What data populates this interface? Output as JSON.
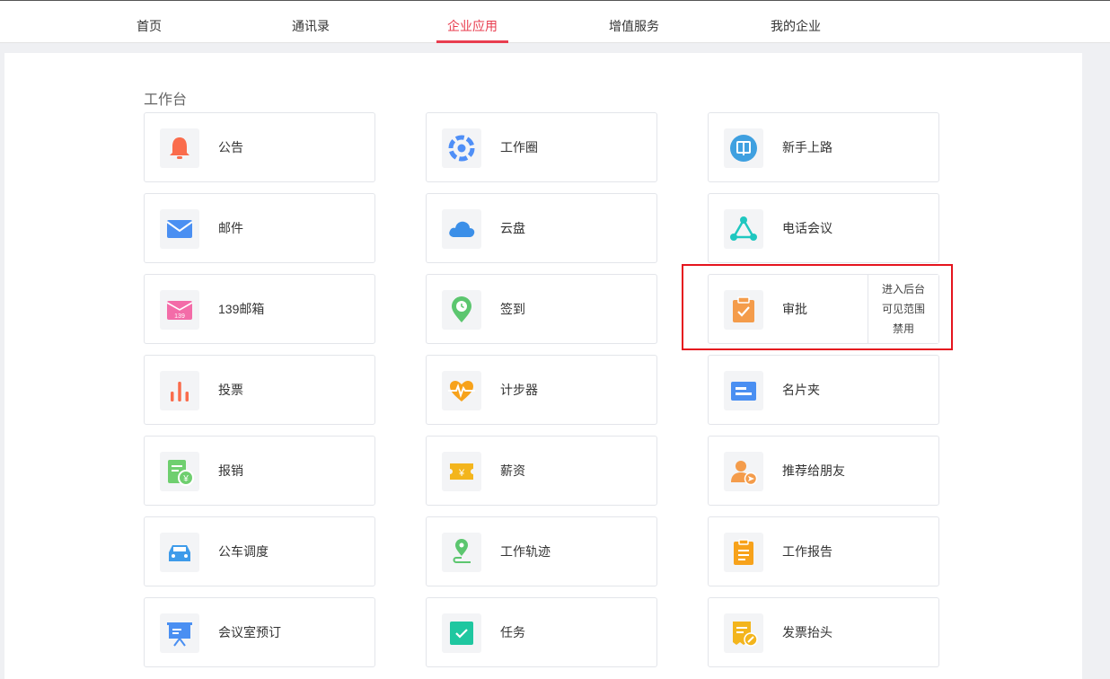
{
  "nav": {
    "items": [
      {
        "label": "首页"
      },
      {
        "label": "通讯录"
      },
      {
        "label": "企业应用"
      },
      {
        "label": "增值服务"
      },
      {
        "label": "我的企业"
      }
    ],
    "active_index": 2,
    "active_color": "#e83d4f"
  },
  "section": {
    "title": "工作台"
  },
  "apps": [
    {
      "label": "公告",
      "icon": "bell-icon",
      "color": "#fa6c4c"
    },
    {
      "label": "工作圈",
      "icon": "work-circle-icon",
      "color": "#4f8ff7"
    },
    {
      "label": "新手上路",
      "icon": "beginner-guide-icon",
      "color": "#3fa0e0"
    },
    {
      "label": "邮件",
      "icon": "mail-icon",
      "color": "#4a8ff2"
    },
    {
      "label": "云盘",
      "icon": "cloud-icon",
      "color": "#3b8fe8"
    },
    {
      "label": "电话会议",
      "icon": "phone-conference-icon",
      "color": "#1fc7c0"
    },
    {
      "label": "139邮箱",
      "icon": "mailbox-139-icon",
      "color": "#f36ca8",
      "badge": "139"
    },
    {
      "label": "签到",
      "icon": "check-in-location-icon",
      "color": "#5cc66f"
    },
    {
      "label": "审批",
      "icon": "approval-clipboard-icon",
      "color": "#f49c4b"
    },
    {
      "label": "投票",
      "icon": "vote-bar-chart-icon",
      "color": "#fa6c4c"
    },
    {
      "label": "计步器",
      "icon": "pedometer-heartbeat-icon",
      "color": "#f7a21b"
    },
    {
      "label": "名片夹",
      "icon": "business-card-icon",
      "color": "#4a8ff2"
    },
    {
      "label": "报销",
      "icon": "reimbursement-icon",
      "color": "#6fcf6f"
    },
    {
      "label": "薪资",
      "icon": "salary-icon",
      "color": "#f3b51d"
    },
    {
      "label": "推荐给朋友",
      "icon": "recommend-friend-icon",
      "color": "#f49c4b"
    },
    {
      "label": "公车调度",
      "icon": "car-icon",
      "color": "#3e9bea"
    },
    {
      "label": "工作轨迹",
      "icon": "work-track-icon",
      "color": "#5cc66f"
    },
    {
      "label": "工作报告",
      "icon": "work-report-icon",
      "color": "#f7a21b"
    },
    {
      "label": "会议室预订",
      "icon": "meeting-room-icon",
      "color": "#4a8ff2"
    },
    {
      "label": "任务",
      "icon": "task-check-icon",
      "color": "#1fc7a0"
    },
    {
      "label": "发票抬头",
      "icon": "invoice-title-icon",
      "color": "#f3b51d"
    }
  ],
  "approval_actions": {
    "enter_backend": "进入后台",
    "visibility": "可见范围",
    "disable": "禁用"
  },
  "highlight_color": "#e5141e"
}
